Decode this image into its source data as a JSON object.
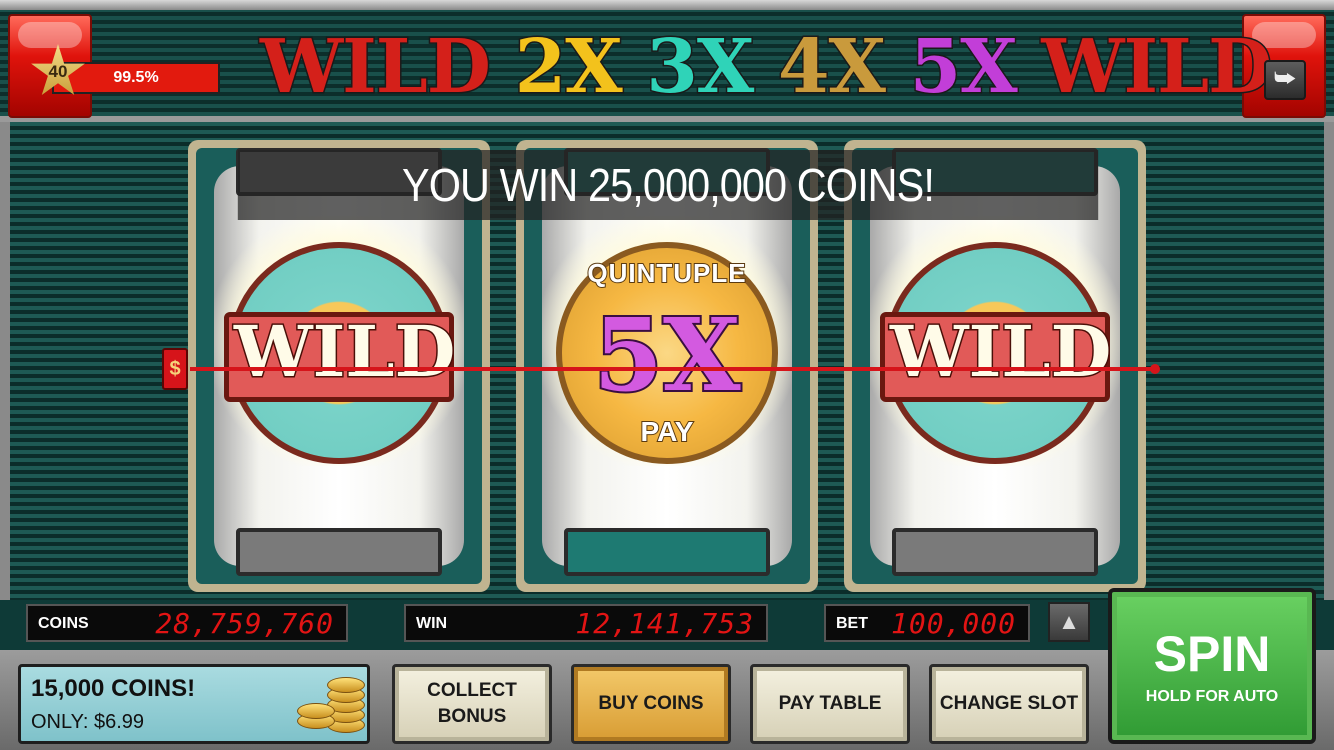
{
  "header": {
    "player_level": "40",
    "level_progress": "99.5%",
    "level_progress_fraction": 0.995,
    "title_parts": [
      "WILD",
      "2X",
      "3X",
      "4X",
      "5X",
      "WILD"
    ],
    "exit_icon": "exit-icon"
  },
  "reels": {
    "left_symbol": "WILD",
    "middle_symbol": {
      "top_text": "QUINTUPLE",
      "main_text": "5X",
      "bottom_text": "PAY"
    },
    "right_symbol": "WILD",
    "payline_marker": "$"
  },
  "win_message": "YOU WIN 25,000,000 COINS!",
  "meters": {
    "coins_label": "COINS",
    "coins_value": "28,759,760",
    "win_label": "WIN",
    "win_value": "12,141,753",
    "bet_label": "BET",
    "bet_value": "100,000"
  },
  "bottom": {
    "promo_title": "15,000 COINS!",
    "promo_price": "ONLY: $6.99",
    "collect_bonus": "COLLECT BONUS",
    "buy_coins": "BUY COINS",
    "pay_table": "PAY TABLE",
    "change_slot": "CHANGE SLOT",
    "spin_label": "SPIN",
    "spin_sub": "HOLD FOR AUTO"
  },
  "colors": {
    "wild_red": "#d4201a",
    "two_x_yellow": "#f3c21c",
    "three_x_teal": "#2fd3b8",
    "four_x_gold": "#c99a3c",
    "five_x_purple": "#c23ed8",
    "meter_digits": "#e21414",
    "spin_green": "#3fae3f"
  }
}
